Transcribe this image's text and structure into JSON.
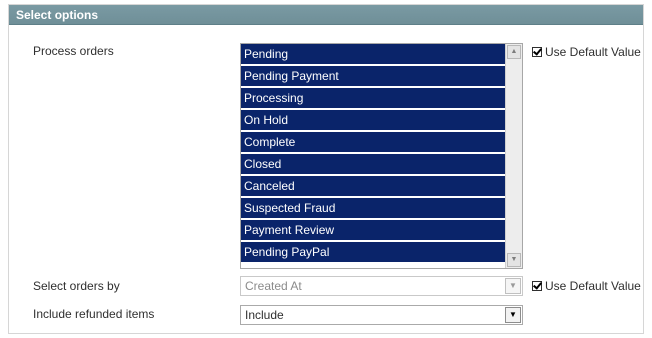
{
  "section": {
    "title": "Select options"
  },
  "fields": {
    "process_orders": {
      "label": "Process orders",
      "options": [
        "Pending",
        "Pending Payment",
        "Processing",
        "On Hold",
        "Complete",
        "Closed",
        "Canceled",
        "Suspected Fraud",
        "Payment Review",
        "Pending PayPal"
      ],
      "use_default_label": "Use Default Value"
    },
    "select_orders_by": {
      "label": "Select orders by",
      "value": "Created At",
      "use_default_label": "Use Default Value"
    },
    "include_refunded": {
      "label": "Include refunded items",
      "value": "Include"
    }
  },
  "icons": {
    "scroll_up": "▲",
    "scroll_down": "▼",
    "dropdown": "▼"
  },
  "colors": {
    "header": "#7290a0",
    "selected": "#0a246a"
  }
}
